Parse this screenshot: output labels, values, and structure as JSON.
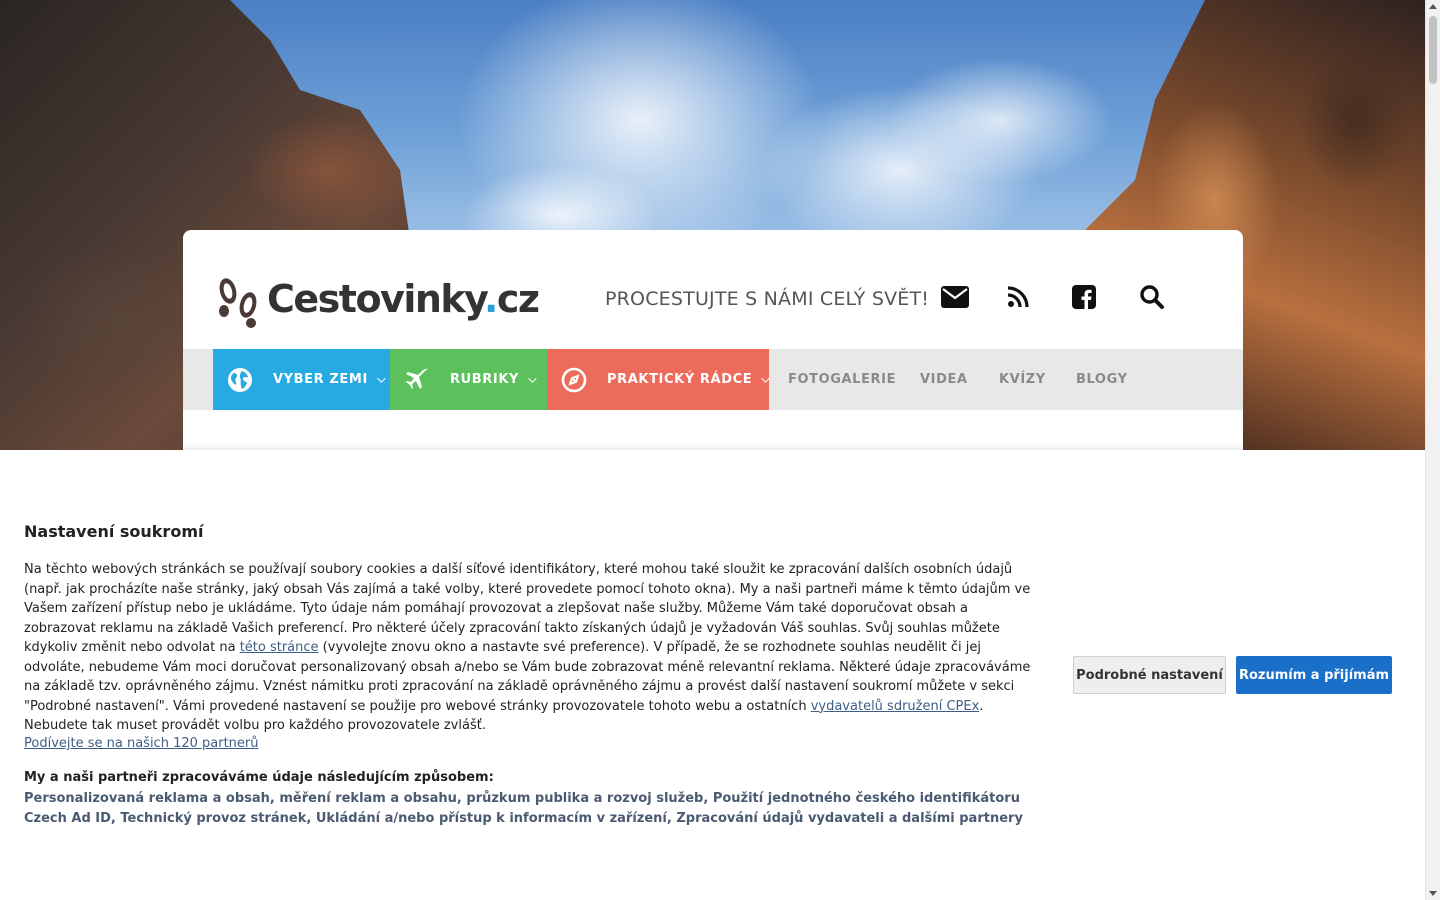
{
  "site": {
    "logo_text_main": "Cestovinky",
    "logo_text_dot": ".",
    "logo_text_tld": "cz",
    "tagline": "PROCESTUJTE S NÁMI CELÝ SVĚT!",
    "header_icons": [
      "envelope-icon",
      "rss-icon",
      "facebook-icon",
      "search-icon"
    ]
  },
  "nav": {
    "items": [
      {
        "label": "VYBER ZEMI",
        "color": "#27a9e1",
        "icon": "globe-icon",
        "dropdown": true
      },
      {
        "label": "RUBRIKY",
        "color": "#5cc15c",
        "icon": "plane-icon",
        "dropdown": true
      },
      {
        "label": "PRAKTICKÝ RÁDCE",
        "color": "#ec6b5a",
        "icon": "compass-icon",
        "dropdown": true
      },
      {
        "label": "FOTOGALERIE"
      },
      {
        "label": "VIDEA"
      },
      {
        "label": "KVÍZY"
      },
      {
        "label": "BLOGY"
      }
    ]
  },
  "consent": {
    "title": "Nastavení soukromí",
    "text_part1": "Na těchto webových stránkách se používají soubory cookies a další síťové identifikátory, které mohou také sloužit ke zpracování dalších osobních údajů (např. jak procházíte naše stránky, jaký obsah Vás zajímá a také volby, které provedete pomocí tohoto okna). My a naši partneři máme k těmto údajům ve Vašem zařízení přístup nebo je ukládáme. Tyto údaje nám pomáhají provozovat a zlepšovat naše služby. Můžeme Vám také doporučovat obsah a zobrazovat reklamu na základě Vašich preferencí. Pro některé účely zpracování takto získaných údajů je vyžadován Váš souhlas. Svůj souhlas můžete kdykoliv změnit nebo odvolat na ",
    "link_this_page": "této stránce",
    "text_part2": " (vyvolejte znovu okno a nastavte své preference). V případě, že se rozhodnete souhlas neudělit či jej odvoláte, nebudeme Vám moci doručovat personalizovaný obsah a/nebo se Vám bude zobrazovat méně relevantní reklama. Některé údaje zpracováváme na základě tzv. oprávněného zájmu. Vznést námitku proti zpracování na základě oprávněného zájmu a provést další nastavení soukromí můžete v sekci \"Podrobné nastavení\". Vámi provedené nastavení se použije pro webové stránky provozovatele tohoto webu a ostatních ",
    "link_cpex": "vydavatelů sdružení CPEx",
    "text_part3": ". Nebudete tak muset provádět volbu pro každého provozovatele zvlášť.",
    "partners_link": "Podívejte se na našich 120 partnerů",
    "purposes_heading": "My a naši partneři zpracováváme údaje následujícím způsobem:",
    "purposes": "Personalizovaná reklama a obsah, měření reklam a obsahu, průzkum publika a rozvoj služeb, Použití jednotného českého identifikátoru Czech Ad ID, Technický provoz stránek, Ukládání a/nebo přístup k informacím v zařízení, Zpracování údajů vydavateli a dalšími partnery",
    "btn_detail": "Podrobné nastavení",
    "btn_accept": "Rozumím a přijímám",
    "accent_color": "#1a6fc9"
  }
}
